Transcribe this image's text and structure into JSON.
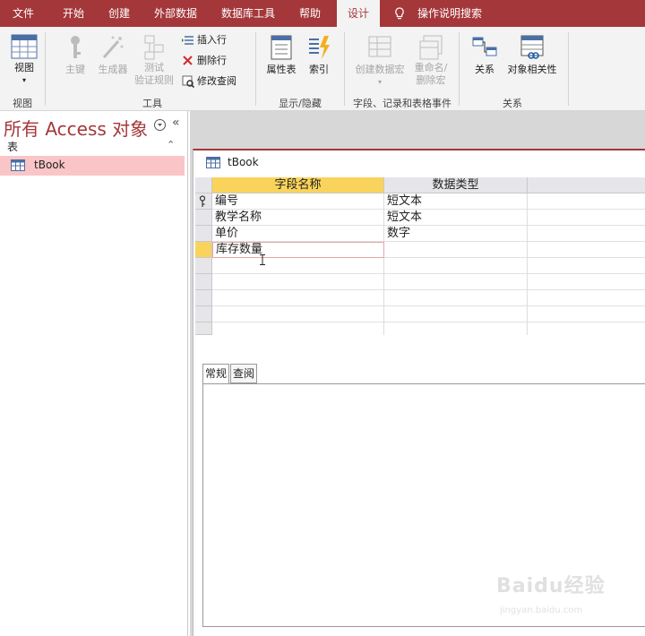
{
  "tabs": [
    {
      "label": "文件"
    },
    {
      "label": "开始"
    },
    {
      "label": "创建"
    },
    {
      "label": "外部数据"
    },
    {
      "label": "数据库工具"
    },
    {
      "label": "帮助"
    },
    {
      "label": "设计"
    }
  ],
  "tellme_label": "操作说明搜索",
  "ribbon": {
    "view": {
      "label": "视图",
      "group": "视图"
    },
    "tools": {
      "group": "工具",
      "primary_key": "主键",
      "builder": "生成器",
      "test_rules_1": "测试",
      "test_rules_2": "验证规则",
      "insert_rows": "插入行",
      "delete_rows": "删除行",
      "modify_lookups": "修改查阅"
    },
    "showhide": {
      "group": "显示/隐藏",
      "property_sheet": "属性表",
      "indexes": "索引"
    },
    "events": {
      "group": "字段、记录和表格事件",
      "create_macros": "创建数据宏",
      "rename_1": "重命名/",
      "rename_2": "删除宏"
    },
    "relationships": {
      "group": "关系",
      "relationships": "关系",
      "dependencies": "对象相关性"
    }
  },
  "nav": {
    "title": "所有 Access 对象",
    "section": "表",
    "items": [
      {
        "label": "tBook"
      }
    ]
  },
  "document": {
    "tab_title": "tBook",
    "columns": [
      "字段名称",
      "数据类型"
    ],
    "rows": [
      {
        "field": "编号",
        "type": "短文本"
      },
      {
        "field": "教学名称",
        "type": "短文本"
      },
      {
        "field": "单价",
        "type": "数字"
      },
      {
        "field": "库存数量",
        "type": ""
      }
    ],
    "prop_tabs": [
      "常规",
      "查阅"
    ]
  },
  "watermark": {
    "brand": "Baidu经验",
    "url": "jingyan.baidu.com"
  },
  "colors": {
    "accent": "#a4373a",
    "selected": "#f9d35b",
    "nav_selected": "#fac5c7"
  }
}
